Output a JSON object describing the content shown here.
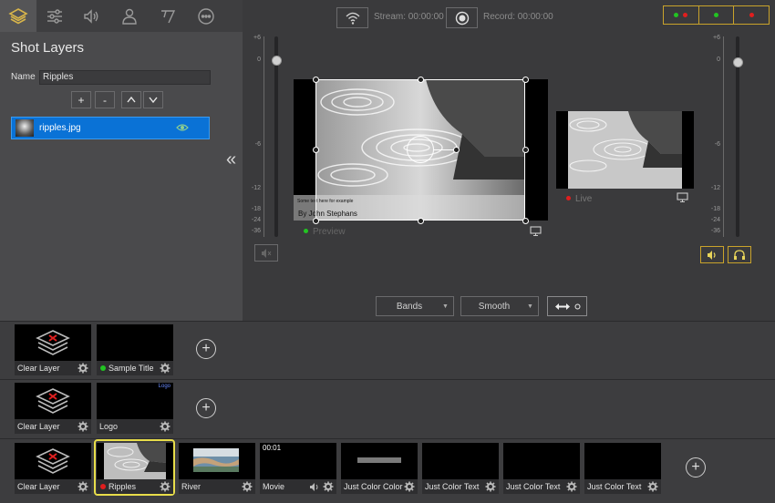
{
  "left_panel": {
    "title": "Shot Layers",
    "name_label": "Name",
    "name_value": "Ripples",
    "layers": [
      {
        "name": "ripples.jpg"
      }
    ],
    "buttons": {
      "add": "+",
      "remove": "-"
    }
  },
  "toolbar": {
    "stream_label": "Stream: 00:00:00",
    "record_label": "Record: 00:00:00"
  },
  "preview": {
    "label": "Preview",
    "caption_small": "Some text here for example",
    "caption": "By John Stephans"
  },
  "live": {
    "label": "Live"
  },
  "audio_scale": [
    "+6",
    "0",
    "-6",
    "-12",
    "-18",
    "-24",
    "-36"
  ],
  "controls": {
    "transition_type": "Bands",
    "easing": "Smooth"
  },
  "rows": [
    {
      "tiles": [
        {
          "name": "Clear Layer"
        },
        {
          "name": "Sample Title"
        }
      ]
    },
    {
      "tiles": [
        {
          "name": "Clear Layer"
        },
        {
          "name": "Logo",
          "badge": "Logo"
        }
      ]
    },
    {
      "tiles": [
        {
          "name": "Clear Layer"
        },
        {
          "name": "Ripples"
        },
        {
          "name": "River"
        },
        {
          "name": "Movie",
          "timecode": "00:01"
        },
        {
          "name": "Just Color Color"
        },
        {
          "name": "Just Color Text"
        },
        {
          "name": "Just Color Text"
        },
        {
          "name": "Just Color Text"
        }
      ]
    }
  ],
  "colors": {
    "accent": "#0a72d6",
    "highlight": "#e8dd4a",
    "live_red": "#e01e1e",
    "preview_green": "#22c422"
  }
}
